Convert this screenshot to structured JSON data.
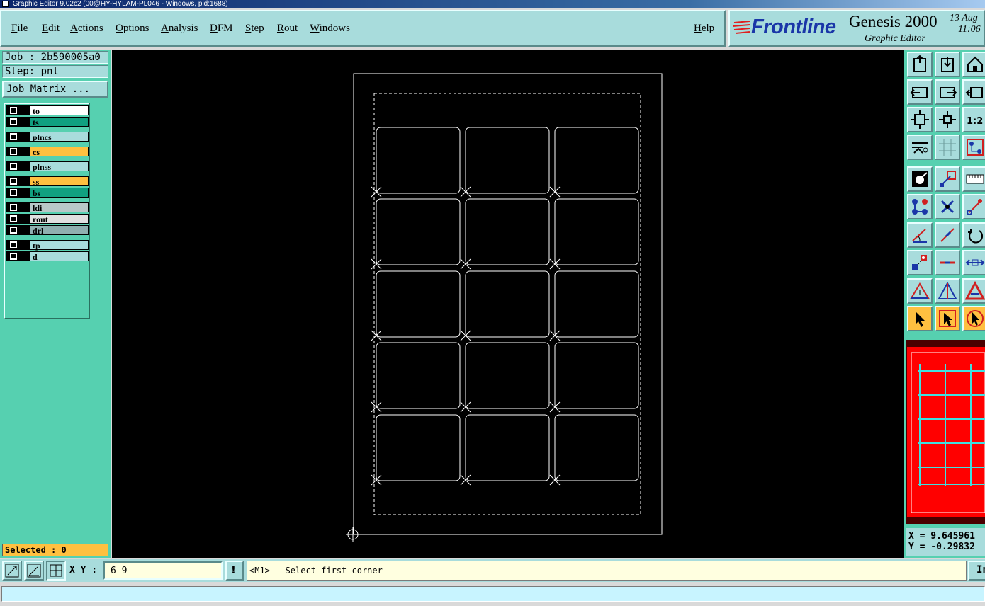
{
  "window": {
    "title": "Graphic Editor 9.02c2 (00@HY-HYLAM-PL046 - Windows, pid:1688)"
  },
  "menu": {
    "items": [
      "File",
      "Edit",
      "Actions",
      "Options",
      "Analysis",
      "DFM",
      "Step",
      "Rout",
      "Windows"
    ],
    "help": "Help"
  },
  "logo": {
    "brand": "Frontline",
    "product": "Genesis 2000",
    "subtitle": "Graphic Editor",
    "date": "13 Aug",
    "time": "11:06"
  },
  "job": {
    "job_label": "Job : 2b590005a0",
    "step_label": "Step: pnl",
    "matrix_button": "Job Matrix ..."
  },
  "layers": [
    {
      "name": "to",
      "color": "#ffffff"
    },
    {
      "name": "ts",
      "color": "#10a080"
    },
    {
      "name": "plncs",
      "color": "#a8dcdc"
    },
    {
      "name": "cs",
      "color": "#ffc040"
    },
    {
      "name": "plnss",
      "color": "#a8dcdc"
    },
    {
      "name": "ss",
      "color": "#ffc040"
    },
    {
      "name": "bs",
      "color": "#10a080"
    },
    {
      "name": "ldi",
      "color": "#b8c8c8"
    },
    {
      "name": "rout",
      "color": "#e0e0e0"
    },
    {
      "name": "drl",
      "color": "#90b0b0"
    },
    {
      "name": "tp",
      "color": "#a8dcdc"
    },
    {
      "name": "d",
      "color": "#a8dcdc"
    }
  ],
  "selection": {
    "text": "Selected : 0"
  },
  "coordinates": {
    "x": "X = 9.645961",
    "y": "Y = -0.29832"
  },
  "command": {
    "xy_label": "X Y :",
    "xy_value": "6 9",
    "alert_icon": "!",
    "prompt": "<M1> - Select first corner",
    "in_button": "In"
  },
  "toolbox": {
    "icons": [
      "open-job-icon",
      "save-icon",
      "home-icon",
      "step-back-icon",
      "step-forward-icon",
      "zoom-reset-icon",
      "zoom-fit-icon",
      "zoom-center-icon",
      "zoom-1to2-icon",
      "tools-icon",
      "grid-icon",
      "netlist-icon",
      "pad-icon",
      "line-rect-icon",
      "ruler-icon",
      "connect-icon",
      "intersect-icon",
      "point-icon",
      "angle-icon",
      "slant-line-icon",
      "rotate-icon",
      "move-icon",
      "line-icon",
      "measure-icon",
      "triangle-icon",
      "triangle-blue-icon",
      "triangle-red-icon",
      "select-arrow-icon",
      "select-box-icon",
      "select-circle-icon"
    ],
    "zoom_label": "1:2"
  },
  "colors": {
    "panel": "#56d0b0",
    "menu": "#a8dcdc",
    "canvas": "#000000",
    "highlight": "#ffc040",
    "overview_fill": "#ff0000",
    "overview_lines": "#40e0e0"
  }
}
